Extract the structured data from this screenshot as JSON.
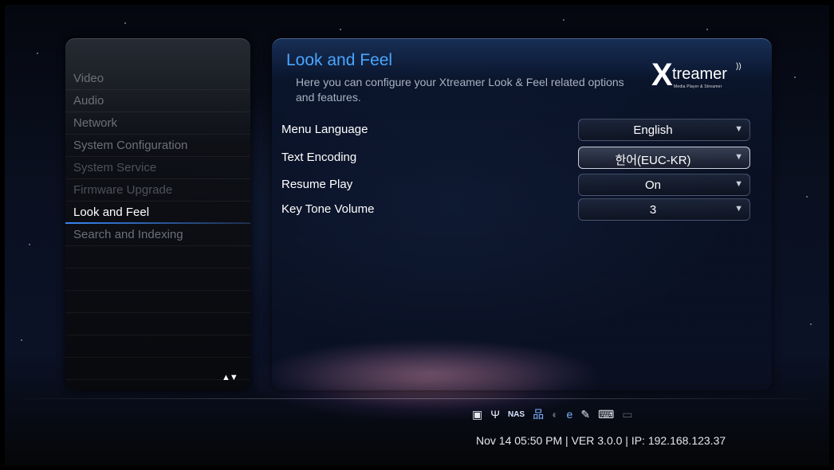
{
  "sidebar": {
    "items": [
      {
        "label": "Video",
        "state": "normal"
      },
      {
        "label": "Audio",
        "state": "normal"
      },
      {
        "label": "Network",
        "state": "normal"
      },
      {
        "label": "System Configuration",
        "state": "normal"
      },
      {
        "label": "System Service",
        "state": "dim"
      },
      {
        "label": "Firmware Upgrade",
        "state": "dim"
      },
      {
        "label": "Look and Feel",
        "state": "active"
      },
      {
        "label": "Search and Indexing",
        "state": "normal"
      }
    ],
    "scroll_arrows": "▲▼"
  },
  "main": {
    "title": "Look and Feel",
    "description": "Here you can configure your Xtreamer Look & Feel related options and features.",
    "logo": {
      "letter": "X",
      "word": "treamer",
      "tagline": "Media Player & Streamer"
    },
    "settings": [
      {
        "label": "Menu Language",
        "value": "English"
      },
      {
        "label": "Text Encoding",
        "value": "한어(EUC-KR)"
      },
      {
        "label": "Resume Play",
        "value": "On"
      },
      {
        "label": "Key Tone Volume",
        "value": "3"
      }
    ],
    "focused_setting": 1
  },
  "statusbar": {
    "icons": [
      "sd-card-icon",
      "usb-icon",
      "nas-icon",
      "network-icon",
      "wifi-adapter-icon",
      "ie-icon",
      "remote-icon",
      "keyboard-icon",
      "storage-icon"
    ],
    "nas_label": "NAS",
    "info": "Nov 14 05:50 PM | VER 3.0.0 | IP: 192.168.123.37"
  },
  "colors": {
    "accent": "#4aa5ff",
    "active_underline": "#3c8cff"
  }
}
